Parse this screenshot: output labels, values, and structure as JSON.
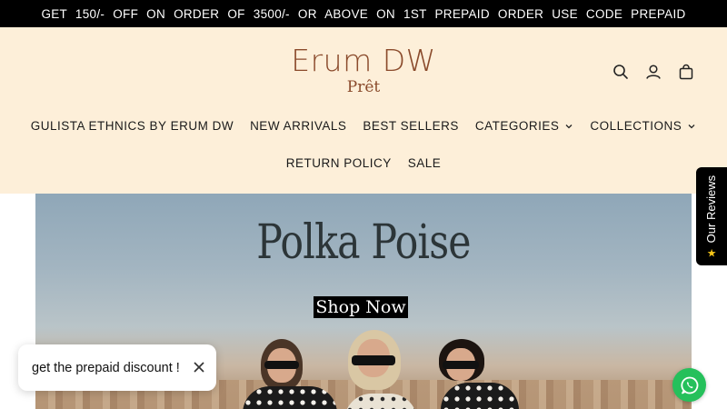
{
  "announcement": "GET 150/- OFF ON ORDER OF 3500/- OR ABOVE ON 1ST PREPAID ORDER USE CODE PREPAID",
  "brand": {
    "name": "Erum DW",
    "tagline": "Prêt",
    "color": "#8a4a2b"
  },
  "header": {
    "background": "#fdefd9",
    "icons": [
      "search-icon",
      "account-icon",
      "cart-icon"
    ]
  },
  "nav": {
    "row1": [
      {
        "label": "GULISTA ETHNICS BY ERUM DW"
      },
      {
        "label": "NEW ARRIVALS"
      },
      {
        "label": "BEST SELLERS"
      },
      {
        "label": "CATEGORIES",
        "dropdown": true
      },
      {
        "label": "COLLECTIONS",
        "dropdown": true
      }
    ],
    "row2": [
      {
        "label": "RETURN POLICY"
      },
      {
        "label": "SALE"
      }
    ]
  },
  "hero": {
    "title": "Polka Poise",
    "cta": "Shop Now"
  },
  "reviews_tab": {
    "label": "Our Reviews",
    "icon": "star-icon"
  },
  "toast": {
    "text": "get the prepaid discount !"
  },
  "whatsapp": {
    "icon": "whatsapp-icon",
    "color": "#25c05b"
  }
}
